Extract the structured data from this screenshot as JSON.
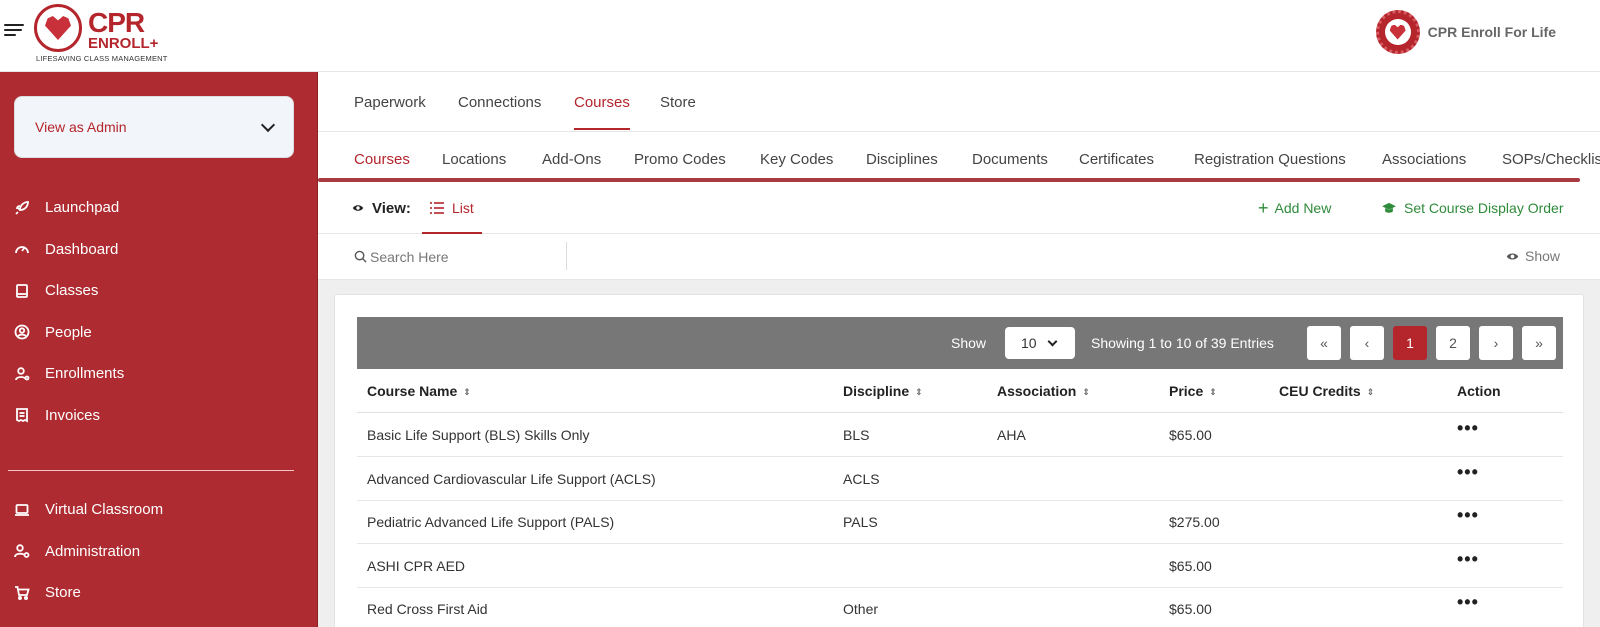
{
  "brand": {
    "logo_primary": "CPR",
    "logo_secondary": "ENROLL+",
    "logo_tagline": "LIFESAVING CLASS MANAGEMENT",
    "org_name": "CPR Enroll For Life",
    "accent": "#b4252c",
    "success": "#2e8b3a"
  },
  "sidebar": {
    "role_select": "View as Admin",
    "items": [
      {
        "label": "Launchpad",
        "icon": "rocket-icon"
      },
      {
        "label": "Dashboard",
        "icon": "gauge-icon"
      },
      {
        "label": "Classes",
        "icon": "book-icon"
      },
      {
        "label": "People",
        "icon": "user-circle-icon"
      },
      {
        "label": "Enrollments",
        "icon": "user-enroll-icon"
      },
      {
        "label": "Invoices",
        "icon": "receipt-icon"
      }
    ],
    "items_bottom": [
      {
        "label": "Virtual Classroom",
        "icon": "laptop-icon"
      },
      {
        "label": "Administration",
        "icon": "user-gear-icon"
      },
      {
        "label": "Store",
        "icon": "cart-icon"
      }
    ]
  },
  "tabs_primary": [
    "Paperwork",
    "Connections",
    "Courses",
    "Store"
  ],
  "tabs_primary_active": "Courses",
  "tabs_secondary": [
    "Courses",
    "Locations",
    "Add-Ons",
    "Promo Codes",
    "Key Codes",
    "Disciplines",
    "Documents",
    "Certificates",
    "Registration Questions",
    "Associations",
    "SOPs/Checklis"
  ],
  "tabs_secondary_active": "Courses",
  "view": {
    "label": "View:",
    "mode": "List",
    "add_new": "Add New",
    "set_order": "Set Course Display Order"
  },
  "search": {
    "placeholder": "Search Here",
    "show_label": "Show"
  },
  "table": {
    "show_label": "Show",
    "page_size": "10",
    "entries_text": "Showing 1 to 10 of 39 Entries",
    "pager": [
      "«",
      "‹",
      "1",
      "2",
      "›",
      "»"
    ],
    "current_page": "1",
    "columns": [
      "Course Name",
      "Discipline",
      "Association",
      "Price",
      "CEU Credits",
      "Action"
    ],
    "rows": [
      {
        "name": "Basic Life Support (BLS) Skills Only",
        "discipline": "BLS",
        "association": "AHA",
        "price": "$65.00",
        "ceu": "",
        "action": "•••"
      },
      {
        "name": "Advanced Cardiovascular Life Support (ACLS)",
        "discipline": "ACLS",
        "association": "",
        "price": "",
        "ceu": "",
        "action": "•••"
      },
      {
        "name": "Pediatric Advanced Life Support (PALS)",
        "discipline": "PALS",
        "association": "",
        "price": "$275.00",
        "ceu": "",
        "action": "•••"
      },
      {
        "name": "ASHI CPR AED",
        "discipline": "",
        "association": "",
        "price": "$65.00",
        "ceu": "",
        "action": "•••"
      },
      {
        "name": "Red Cross First Aid",
        "discipline": "Other",
        "association": "",
        "price": "$65.00",
        "ceu": "",
        "action": "•••"
      }
    ]
  }
}
